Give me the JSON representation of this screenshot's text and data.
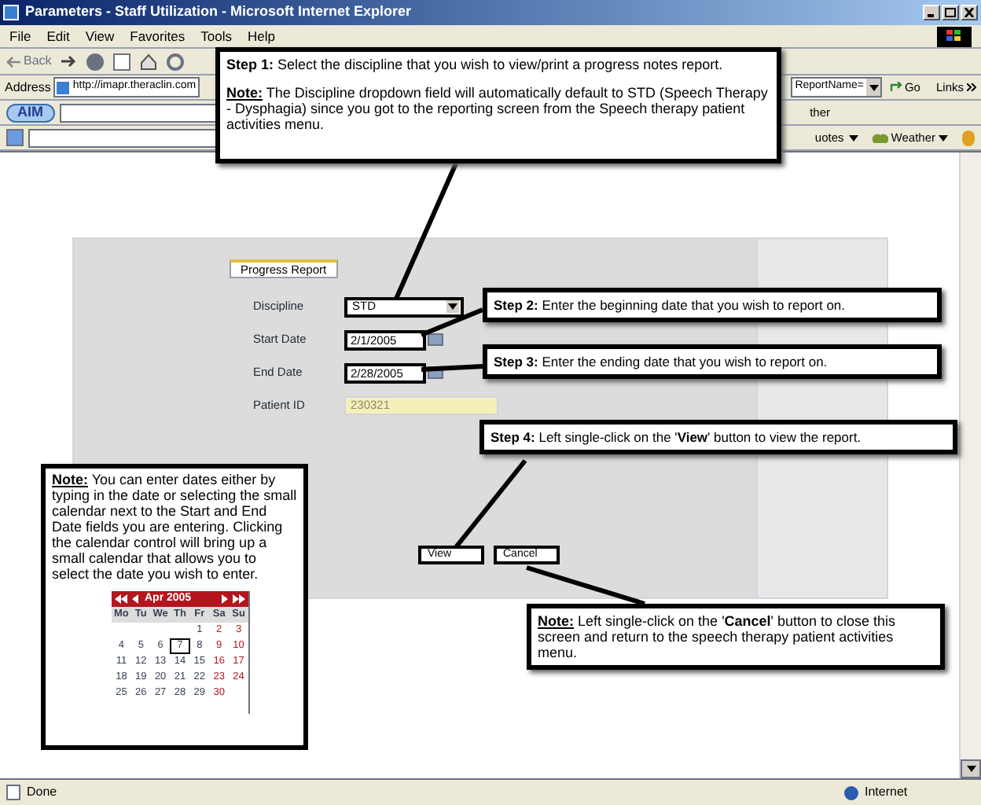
{
  "window": {
    "title": "Parameters - Staff Utilization - Microsoft Internet Explorer"
  },
  "menu": [
    "File",
    "Edit",
    "View",
    "Favorites",
    "Tools",
    "Help"
  ],
  "toolbar": {
    "back": "Back"
  },
  "address_bar": {
    "label": "Address",
    "url": "http://imapr.theraclin.com",
    "query": "ReportName=",
    "go": "Go",
    "links": "Links"
  },
  "aim_bar": {
    "label": "AIM",
    "partial": "ther"
  },
  "search_bar": {
    "quotes": "uotes",
    "weather": "Weather"
  },
  "form": {
    "tab": "Progress Report",
    "fields": [
      {
        "kind": "select",
        "label": "Discipline",
        "value": "STD"
      },
      {
        "kind": "date",
        "label": "Start Date",
        "value": "2/1/2005"
      },
      {
        "kind": "date",
        "label": "End Date",
        "value": "2/28/2005"
      },
      {
        "kind": "readonly",
        "label": "Patient ID",
        "value": "230321"
      }
    ],
    "buttons": [
      "View",
      "Cancel"
    ]
  },
  "callouts": [
    {
      "paragraphs": [
        {
          "lead": "Step 1:",
          "underline": false,
          "text": "Select the discipline that you wish to view/print a progress notes report."
        },
        {
          "lead": "Note:",
          "underline": true,
          "text": "The Discipline dropdown field will automatically default to STD (Speech Therapy - Dysphagia) since you got to the reporting screen from the Speech therapy patient activities menu."
        }
      ]
    },
    {
      "paragraphs": [
        {
          "lead": "Step 2:",
          "underline": false,
          "text": "Enter the beginning date that you wish to report on."
        }
      ]
    },
    {
      "paragraphs": [
        {
          "lead": "Step 3:",
          "underline": false,
          "text": "Enter the ending date that you wish to report on."
        }
      ]
    },
    {
      "paragraphs": [
        {
          "lead": "Step 4:",
          "underline": false,
          "text": "Left single-click on the '**View**' button to view the report."
        }
      ]
    },
    {
      "paragraphs": [
        {
          "lead": "Note:",
          "underline": true,
          "text": "You can enter dates either by typing in the date or selecting the small calendar next to the Start and End Date fields you are entering. Clicking the calendar control will bring up a small calendar that allows you to select the date you wish to enter."
        }
      ]
    },
    {
      "paragraphs": [
        {
          "lead": "Note:",
          "underline": true,
          "text": "Left single-click on the '**Cancel**' button to close this screen and return to the speech therapy patient activities menu."
        }
      ]
    }
  ],
  "calendar": {
    "month": "Apr 2005",
    "weekdays": [
      "Mo",
      "Tu",
      "We",
      "Th",
      "Fr",
      "Sa",
      "Su"
    ],
    "weeks": [
      [
        {
          "kind": "blank"
        },
        {
          "kind": "blank"
        },
        {
          "kind": "blank"
        },
        {
          "kind": "blank"
        },
        {
          "kind": "day",
          "day": "1",
          "selected": false
        },
        {
          "kind": "day",
          "day": "2",
          "selected": false
        },
        {
          "kind": "day",
          "day": "3",
          "selected": false
        }
      ],
      [
        {
          "kind": "day",
          "day": "4",
          "selected": false
        },
        {
          "kind": "day",
          "day": "5",
          "selected": false
        },
        {
          "kind": "day",
          "day": "6",
          "selected": false
        },
        {
          "kind": "day",
          "day": "7",
          "selected": true
        },
        {
          "kind": "day",
          "day": "8",
          "selected": false
        },
        {
          "kind": "day",
          "day": "9",
          "selected": false
        },
        {
          "kind": "day",
          "day": "10",
          "selected": false
        }
      ],
      [
        {
          "kind": "day",
          "day": "11",
          "selected": false
        },
        {
          "kind": "day",
          "day": "12",
          "selected": false
        },
        {
          "kind": "day",
          "day": "13",
          "selected": false
        },
        {
          "kind": "day",
          "day": "14",
          "selected": false
        },
        {
          "kind": "day",
          "day": "15",
          "selected": false
        },
        {
          "kind": "day",
          "day": "16",
          "selected": false
        },
        {
          "kind": "day",
          "day": "17",
          "selected": false
        }
      ],
      [
        {
          "kind": "day",
          "day": "18",
          "selected": false
        },
        {
          "kind": "day",
          "day": "19",
          "selected": false
        },
        {
          "kind": "day",
          "day": "20",
          "selected": false
        },
        {
          "kind": "day",
          "day": "21",
          "selected": false
        },
        {
          "kind": "day",
          "day": "22",
          "selected": false
        },
        {
          "kind": "day",
          "day": "23",
          "selected": false
        },
        {
          "kind": "day",
          "day": "24",
          "selected": false
        }
      ],
      [
        {
          "kind": "day",
          "day": "25",
          "selected": false
        },
        {
          "kind": "day",
          "day": "26",
          "selected": false
        },
        {
          "kind": "day",
          "day": "27",
          "selected": false
        },
        {
          "kind": "day",
          "day": "28",
          "selected": false
        },
        {
          "kind": "day",
          "day": "29",
          "selected": false
        },
        {
          "kind": "day",
          "day": "30",
          "selected": false
        },
        {
          "kind": "blank"
        }
      ]
    ]
  },
  "status_bar": {
    "status": "Done",
    "zone": "Internet"
  }
}
